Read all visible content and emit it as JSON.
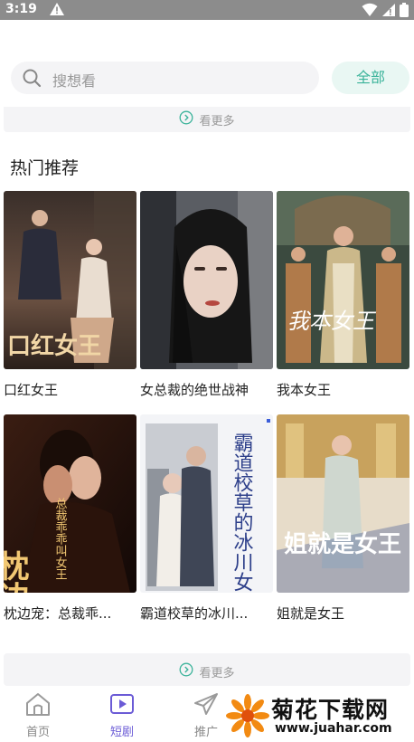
{
  "status_bar": {
    "time": "3:19"
  },
  "search": {
    "placeholder": "搜想看",
    "all_label": "全部"
  },
  "more_top": {
    "label": "看更多"
  },
  "section": {
    "title": "热门推荐"
  },
  "dramas": [
    {
      "title": "口红女王",
      "poster_text": "口红女王"
    },
    {
      "title": "女总裁的绝世战神",
      "poster_text": ""
    },
    {
      "title": "我本女王",
      "poster_text": "我本女王"
    },
    {
      "title": "枕边宠：总裁乖...",
      "poster_text": "枕边宠",
      "poster_subtext": "总裁乖乖叫女王"
    },
    {
      "title": "霸道校草的冰川...",
      "poster_text": "霸道校草的冰川女王"
    },
    {
      "title": "姐就是女王",
      "poster_text": "姐就是女王"
    }
  ],
  "more_bottom": {
    "label": "看更多"
  },
  "nav": [
    {
      "label": "首页",
      "icon": "home-icon"
    },
    {
      "label": "短剧",
      "icon": "play-icon"
    },
    {
      "label": "推广",
      "icon": "paper-plane-icon"
    }
  ],
  "watermark": {
    "title": "菊花下载网",
    "url": "www.juahar.com"
  },
  "colors": {
    "accent": "#3bb39a",
    "nav_active": "#6b5bd6",
    "status_bar": "#8c8c8c"
  }
}
